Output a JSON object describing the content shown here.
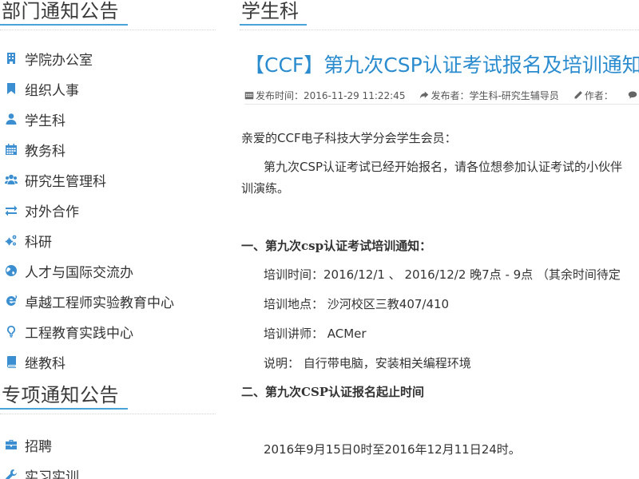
{
  "sidebar": {
    "dept_title": "部门通知公告",
    "dept_items": [
      {
        "label": "学院办公室",
        "icon": "building-icon"
      },
      {
        "label": "组织人事",
        "icon": "bookmark-icon"
      },
      {
        "label": "学生科",
        "icon": "user-icon"
      },
      {
        "label": "教务科",
        "icon": "calendar-icon"
      },
      {
        "label": "研究生管理科",
        "icon": "users-icon"
      },
      {
        "label": "对外合作",
        "icon": "exchange-icon"
      },
      {
        "label": "科研",
        "icon": "cogs-icon"
      },
      {
        "label": "人才与国际交流办",
        "icon": "globe-icon"
      },
      {
        "label": "卓越工程师实验教育中心",
        "icon": "ie-icon"
      },
      {
        "label": "工程教育实践中心",
        "icon": "lightbulb-icon"
      },
      {
        "label": "继教科",
        "icon": "book-icon"
      }
    ],
    "special_title": "专项通知公告",
    "special_items": [
      {
        "label": "招聘",
        "icon": "briefcase-icon"
      },
      {
        "label": "实习实训",
        "icon": "wrench-icon"
      }
    ]
  },
  "content": {
    "section_title": "学生科",
    "article_title": "【CCF】第九次CSP认证考试报名及培训通知",
    "meta": {
      "published": "发布时间：2016-11-29 11:22:45",
      "publisher": "发布者：学生科-研究生辅导员",
      "author": "作者："
    },
    "paragraphs": {
      "greeting": "亲爱的CCF电子科技大学分会学生会员：",
      "intro_line1": "第九次CSP认证考试已经开始报名，请各位想参加认证考试的小伙伴",
      "intro_line2": "训演练。",
      "heading1": "一、第九次csp认证考试培训通知：",
      "train_time": "培训时间：2016/12/1 、 2016/12/2  晚7点 - 9点 （其余时间待定",
      "train_place": "培训地点： 沙河校区三教407/410",
      "train_lecturer": "培训讲师：  ACMer",
      "train_note": "说明：  自行带电脑，安装相关编程环境",
      "heading2": "二、第九次CSP认证报名起止时间",
      "period": "2016年9月15日0时至2016年12月11日24时。"
    }
  },
  "colors": {
    "accent": "#4aa3d8",
    "title_blue": "#2a8ccf",
    "icon_blue": "#3b8fd0"
  }
}
